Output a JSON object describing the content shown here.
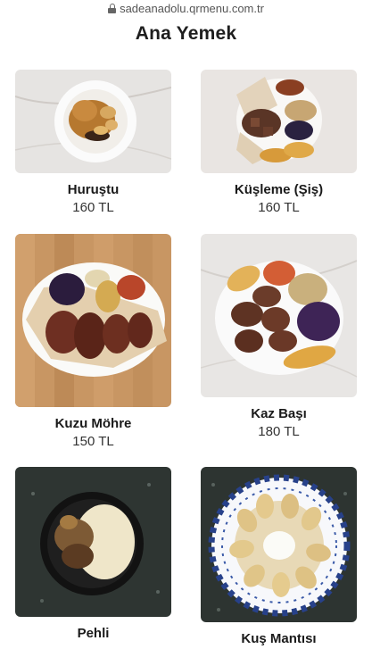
{
  "browser": {
    "url": "sadeanadolu.qrmenu.com.tr"
  },
  "section": {
    "title": "Ana Yemek"
  },
  "items": [
    {
      "name": "Huruştu",
      "price": "160 TL"
    },
    {
      "name": "Küşleme (Şiş)",
      "price": "160 TL"
    },
    {
      "name": "Kuzu Möhre",
      "price": "150 TL"
    },
    {
      "name": "Kaz Başı",
      "price": "180 TL"
    },
    {
      "name": "Pehli",
      "price": ""
    },
    {
      "name": "Kuş Mantısı",
      "price": ""
    }
  ]
}
